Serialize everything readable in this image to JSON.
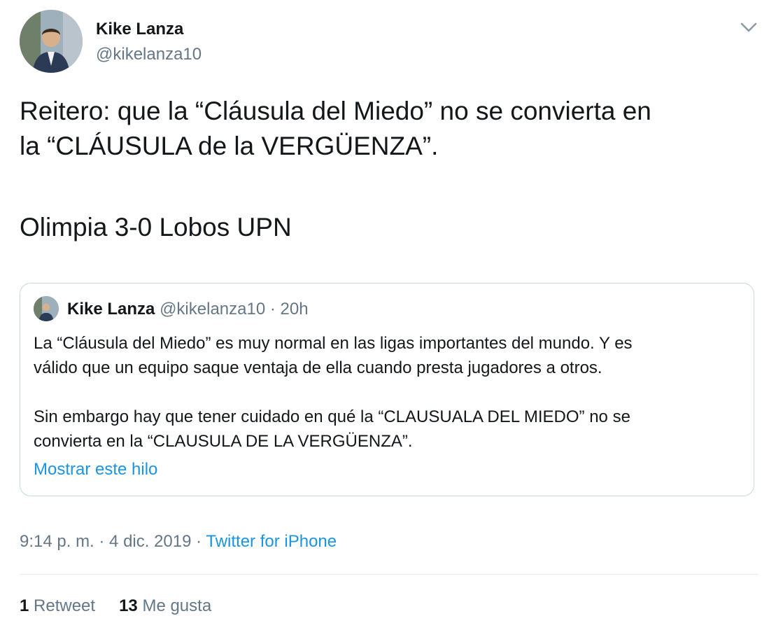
{
  "author": {
    "name": "Kike Lanza",
    "handle": "@kikelanza10"
  },
  "tweet": {
    "lines": [
      "Reitero: que la “Cláusula del Miedo” no se convierta en",
      "la “CLÁUSULA de la VERGÜENZA”."
    ],
    "score_line": "Olimpia 3-0 Lobos UPN"
  },
  "quoted_tweet": {
    "name": "Kike Lanza",
    "handle_time": "@kikelanza10 · 20h",
    "paragraph1": [
      "La “Cláusula del Miedo” es muy normal en las ligas importantes del mundo. Y es",
      "válido que un equipo saque ventaja de ella cuando presta jugadores a otros."
    ],
    "paragraph2": [
      "Sin embargo hay que tener cuidado en qué la “CLAUSUALA DEL MIEDO” no se",
      "convierta en la “CLAUSULA DE LA VERGÜENZA”."
    ],
    "show_thread": "Mostrar este hilo"
  },
  "timestamp": "9:14 p. m. · 4 dic. 2019 · ",
  "source": "Twitter for iPhone",
  "stats": {
    "retweets_count": "1",
    "retweets_label": "Retweet",
    "likes_count": "13",
    "likes_label": "Me gusta"
  },
  "icons": {
    "caret": "chevron-down-icon",
    "avatar": "profile-photo"
  },
  "colors": {
    "link": "#1b95e0",
    "secondary_text": "#657786",
    "border": "#ccd6dd"
  }
}
